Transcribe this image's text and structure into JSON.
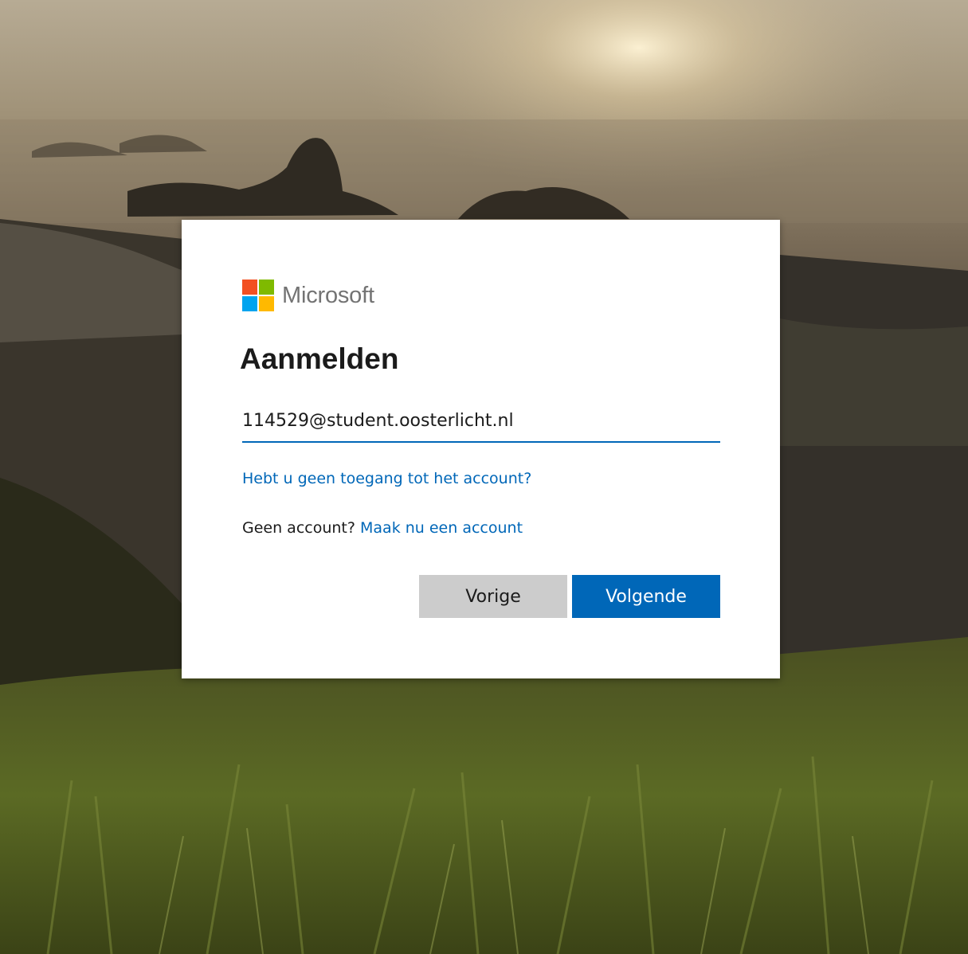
{
  "brand": {
    "name": "Microsoft",
    "logo_colors": [
      "#f25022",
      "#7fba00",
      "#00a4ef",
      "#ffb900"
    ]
  },
  "dialog": {
    "title": "Aanmelden",
    "email_value": "114529@student.oosterlicht.nl",
    "no_access_link": "Hebt u geen toegang tot het account?",
    "no_account_text": "Geen account?",
    "create_account_link": "Maak nu een account",
    "back_button": "Vorige",
    "next_button": "Volgende"
  },
  "colors": {
    "accent": "#0067b8",
    "back_button_bg": "#cccccc"
  }
}
